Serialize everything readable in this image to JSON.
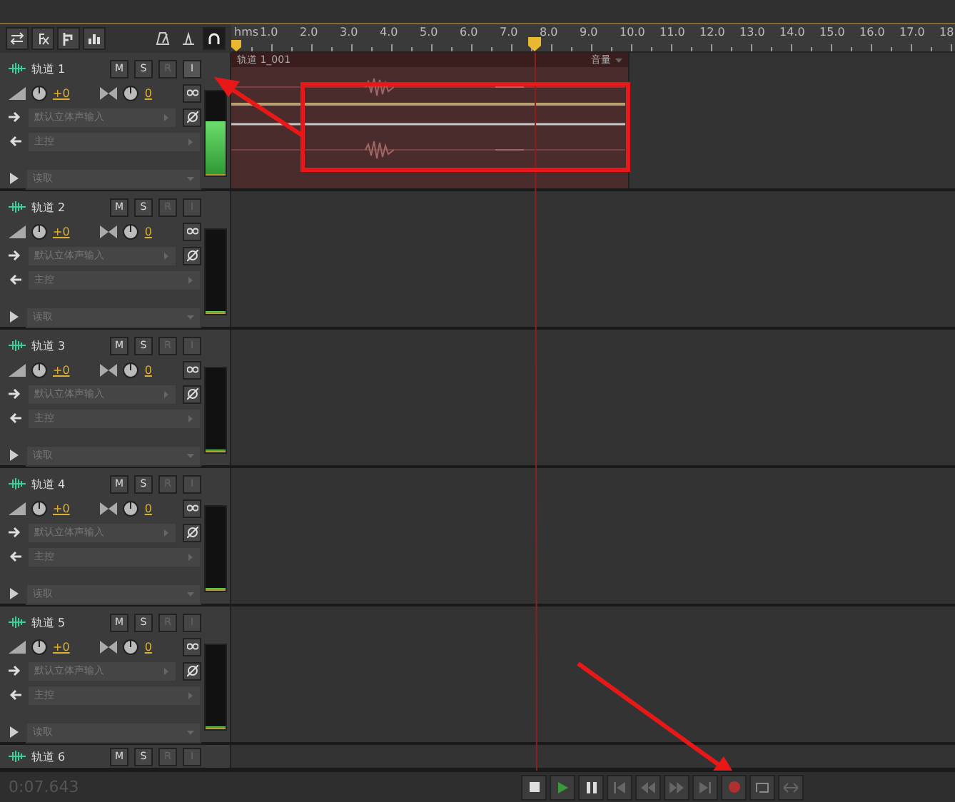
{
  "ruler": {
    "unit": "hms",
    "labels": [
      "1.0",
      "2.0",
      "3.0",
      "4.0",
      "5.0",
      "6.0",
      "7.0",
      "8.0",
      "9.0",
      "10.0",
      "11.0",
      "12.0",
      "13.0",
      "14.0",
      "15.0",
      "16.0",
      "17.0",
      "18."
    ]
  },
  "tracks": [
    {
      "name": "轨道 1",
      "kind": "full",
      "buttons": [
        "M",
        "S",
        "R",
        "I"
      ],
      "input_monitoring": true,
      "volume": "+0",
      "pan": "0",
      "input": "默认立体声输入",
      "output": "主控",
      "automation": "读取",
      "meter": {
        "level": 0.62
      },
      "clip": {
        "title": "轨道 1_001",
        "menu": "音量"
      }
    },
    {
      "name": "轨道 2",
      "kind": "full",
      "buttons": [
        "M",
        "S",
        "R",
        "I"
      ],
      "input_monitoring": false,
      "volume": "+0",
      "pan": "0",
      "input": "默认立体声输入",
      "output": "主控",
      "automation": "读取",
      "meter": {
        "level": 0
      }
    },
    {
      "name": "轨道 3",
      "kind": "full",
      "buttons": [
        "M",
        "S",
        "R",
        "I"
      ],
      "input_monitoring": false,
      "volume": "+0",
      "pan": "0",
      "input": "默认立体声输入",
      "output": "主控",
      "automation": "读取",
      "meter": {
        "level": 0
      }
    },
    {
      "name": "轨道 4",
      "kind": "full",
      "buttons": [
        "M",
        "S",
        "R",
        "I"
      ],
      "input_monitoring": false,
      "volume": "+0",
      "pan": "0",
      "input": "默认立体声输入",
      "output": "主控",
      "automation": "读取",
      "meter": {
        "level": 0
      }
    },
    {
      "name": "轨道 5",
      "kind": "full",
      "buttons": [
        "M",
        "S",
        "R",
        "I"
      ],
      "input_monitoring": false,
      "volume": "+0",
      "pan": "0",
      "input": "默认立体声输入",
      "output": "主控",
      "automation": "读取",
      "meter": {
        "level": 0
      }
    },
    {
      "name": "轨道 6",
      "kind": "partial",
      "buttons": [
        "M",
        "S",
        "R",
        "I"
      ],
      "input_monitoring": false
    }
  ],
  "transport": {
    "time": "0:07.643"
  }
}
